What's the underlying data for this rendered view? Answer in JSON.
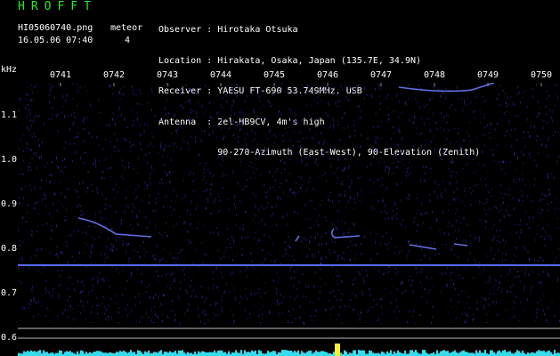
{
  "header": {
    "brand": "HROFFT",
    "filename": "HI05060740.png",
    "timestamp": "16.05.06 07:40",
    "meteor_label": "meteor",
    "meteor_count": "4"
  },
  "info": {
    "observer": "Observer : Hirotaka Otsuka",
    "location": "Location : Hirakata, Osaka, Japan (135.7E, 34.9N)",
    "receiver": "Receiver : YAESU FT-690 53.749MHz, USB",
    "antenna": "Antenna  : 2el-HB9CV, 4m's high",
    "antenna_2": "           90-270-Azimuth (East-West), 90-Elevation (Zenith)"
  },
  "axes": {
    "y_unit": "kHz",
    "y_ticks": [
      "1.1",
      "1.0",
      "0.9",
      "0.8",
      "0.7",
      "0.6"
    ],
    "x_ticks": [
      "0741",
      "0742",
      "0743",
      "0744",
      "0745",
      "0746",
      "0747",
      "0748",
      "0749",
      "0750"
    ]
  },
  "chart_data": {
    "type": "heatmap",
    "title": "",
    "xlabel": "",
    "ylabel": "kHz",
    "x_ticks": [
      "0741",
      "0742",
      "0743",
      "0744",
      "0745",
      "0746",
      "0747",
      "0748",
      "0749",
      "0750"
    ],
    "y_ticks": [
      1.1,
      1.0,
      0.9,
      0.8,
      0.7,
      0.6
    ],
    "carrier_khz": 0.76,
    "meteor_count": 4
  },
  "colors": {
    "background": "#000000",
    "brand": "#22ee22",
    "carrier": "#5a6cff",
    "noise": "#1a1a6a",
    "meteor": "#6a7dff",
    "histogram": "#33ddee",
    "guide": "#bbbbbb"
  }
}
